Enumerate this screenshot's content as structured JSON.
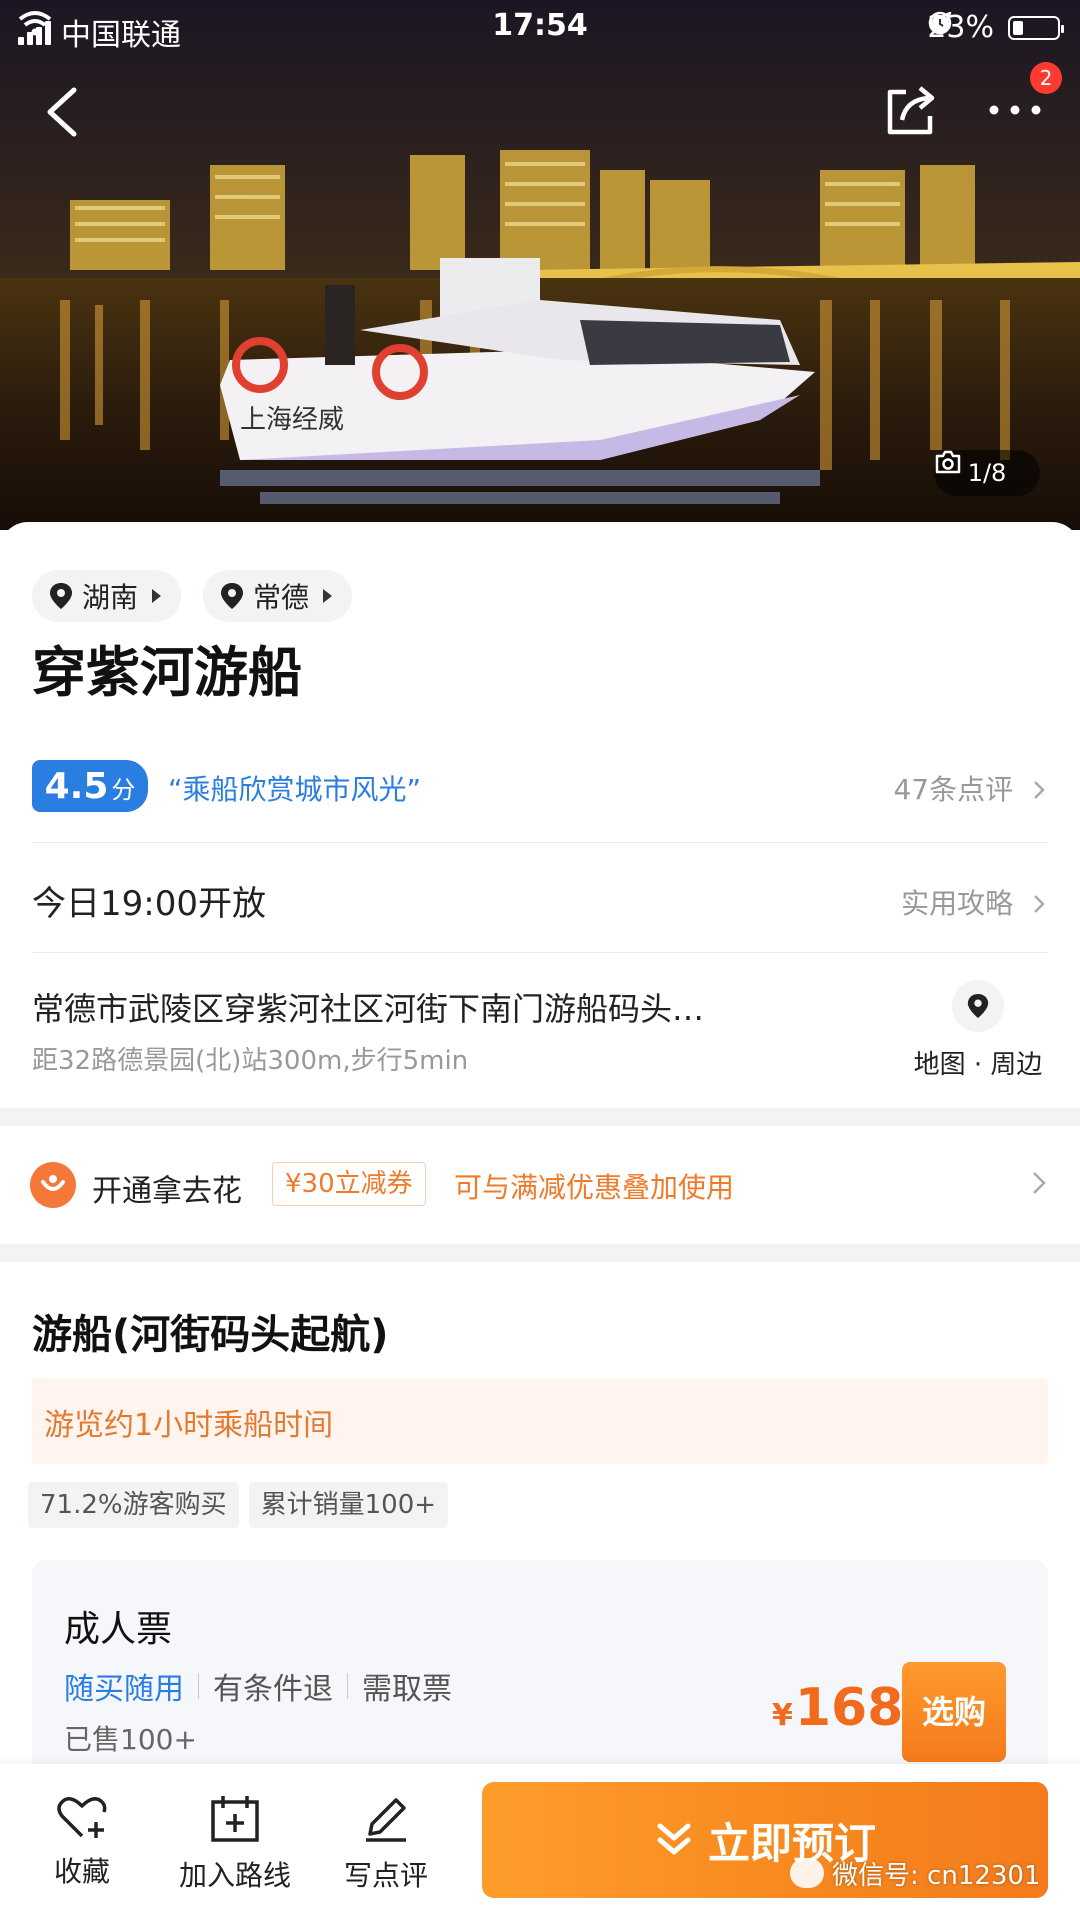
{
  "status_bar": {
    "carrier": "中国联通",
    "time": "17:54",
    "battery": "23%",
    "battery_level": 0.23
  },
  "hero": {
    "notification_count": "2",
    "photo_counter": "1/8",
    "boat_lettering": "上海经威"
  },
  "location_chips": [
    {
      "label": "湖南"
    },
    {
      "label": "常德"
    }
  ],
  "poi": {
    "title": "穿紫河游船",
    "score": "4.5",
    "score_unit": "分",
    "quote": "“乘船欣赏城市风光”",
    "review_count": "47条点评",
    "open_text": "今日19:00开放",
    "guide_link": "实用攻略",
    "address": "常德市武陵区穿紫河社区河街下南门游船码头…",
    "distance": "距32路德景园(北)站300m,步行5min",
    "map_label": "地图 · 周边"
  },
  "promo": {
    "title": "开通拿去花",
    "coupon": "¥30立减券",
    "desc": "可与满减优惠叠加使用"
  },
  "product": {
    "section_title": "游船(河街码头起航)",
    "notice": "游览约1小时乘船时间",
    "tags": [
      "71.2%游客购买",
      "累计销量100+"
    ],
    "ticket": {
      "name": "成人票",
      "feature_highlight": "随买随用",
      "feature_2": "有条件退",
      "feature_3": "需取票",
      "sold": "已售100+",
      "currency": "¥",
      "price": "168",
      "buy_label": "选购"
    }
  },
  "bottom_bar": {
    "favorite": "收藏",
    "add_route": "加入路线",
    "write_review": "写点评",
    "book_now": "立即预订",
    "watermark": "微信号: cn12301"
  },
  "colors": {
    "accent_blue": "#2a7de1",
    "accent_orange": "#f07a2a",
    "price_orange": "#f26a1b"
  }
}
